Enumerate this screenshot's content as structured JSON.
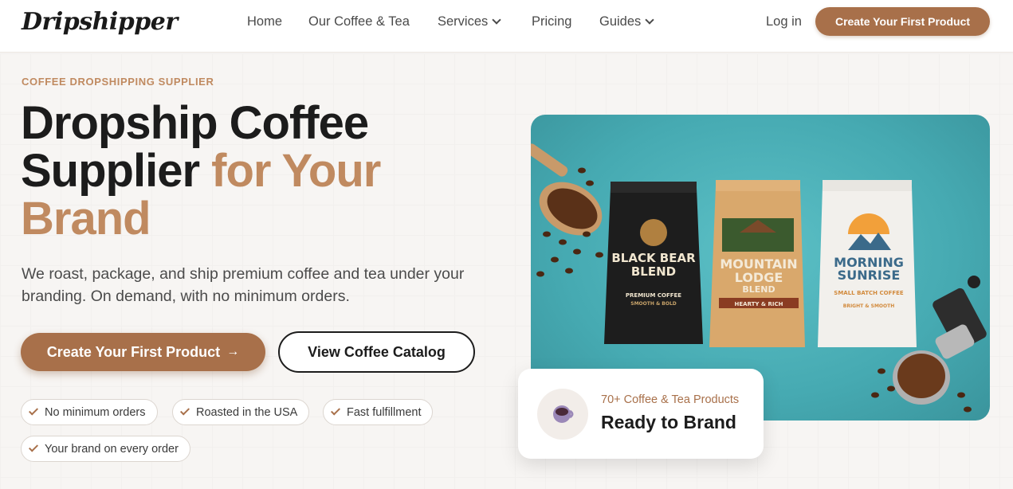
{
  "header": {
    "logo": "Dripshipper",
    "nav": [
      {
        "label": "Home",
        "dropdown": false
      },
      {
        "label": "Our Coffee & Tea",
        "dropdown": false
      },
      {
        "label": "Services",
        "dropdown": true
      },
      {
        "label": "Pricing",
        "dropdown": false
      },
      {
        "label": "Guides",
        "dropdown": true
      }
    ],
    "login": "Log in",
    "cta": "Create Your First Product"
  },
  "hero": {
    "kicker": "COFFEE DROPSHIPPING SUPPLIER",
    "title_part1": "Dropship Coffee Supplier",
    "title_accent": "for Your Brand",
    "lead": "We roast, package, and ship premium coffee and tea under your branding. On demand, with no minimum orders.",
    "primary_button": "Create Your First Product",
    "secondary_button": "View Coffee Catalog",
    "features": [
      "No minimum orders",
      "Roasted in the USA",
      "Fast fulfillment",
      "Your brand on every order"
    ]
  },
  "image": {
    "bags": [
      {
        "name_line1": "BLACK BEAR",
        "name_line2": "BLEND",
        "tag": "PREMIUM COFFEE",
        "sub": "SMOOTH & BOLD"
      },
      {
        "name_line1": "MOUNTAIN",
        "name_line2": "LODGE",
        "name_line3": "BLEND",
        "sub": "HEARTY & RICH"
      },
      {
        "name_line1": "MORNING",
        "name_line2": "SUNRISE",
        "tag": "SMALL BATCH COFFEE",
        "sub": "BRIGHT & SMOOTH"
      }
    ]
  },
  "card": {
    "subtitle": "70+ Coffee & Tea Products",
    "title": "Ready to Brand"
  },
  "colors": {
    "accent": "#a8704a",
    "accent_text": "#c08a60",
    "teal": "#46aab2"
  }
}
